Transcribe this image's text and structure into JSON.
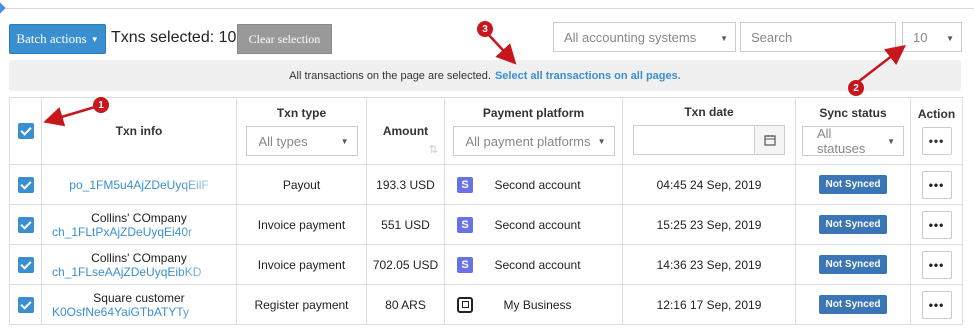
{
  "toolbar": {
    "batch_actions_label": "Batch actions",
    "txns_selected_label": "Txns selected:",
    "txns_selected_count": "10",
    "clear_selection_label": "Clear selection",
    "accounting_select_value": "All accounting systems",
    "search_placeholder": "Search",
    "per_page_value": "10"
  },
  "banner": {
    "text": "All transactions on the page are selected.",
    "link": "Select all transactions on all pages."
  },
  "table": {
    "headers": {
      "txn_info": "Txn info",
      "txn_type": "Txn type",
      "amount": "Amount",
      "payment_platform": "Payment platform",
      "txn_date": "Txn date",
      "sync_status": "Sync status",
      "action": "Action"
    },
    "filters": {
      "txn_type": "All types",
      "payment_platform": "All payment platforms",
      "sync_status": "All statuses"
    },
    "rows": [
      {
        "name": "",
        "id": "po_1FM5u4AjZDeUyqEilF",
        "type": "Payout",
        "amount": "193.3 USD",
        "platform": "Second account",
        "platform_icon": "stripe-icon",
        "date": "04:45 24 Sep, 2019",
        "status": "Not Synced",
        "action": "•••"
      },
      {
        "name": "Collins' COmpany",
        "id": "ch_1FLtPxAjZDeUyqEi40r",
        "type": "Invoice payment",
        "amount": "551 USD",
        "platform": "Second account",
        "platform_icon": "stripe-icon",
        "date": "15:25 23 Sep, 2019",
        "status": "Not Synced",
        "action": "•••"
      },
      {
        "name": "Collins' COmpany",
        "id": "ch_1FLseAAjZDeUyqEibKD",
        "type": "Invoice payment",
        "amount": "702.05 USD",
        "platform": "Second account",
        "platform_icon": "stripe-icon",
        "date": "14:36 23 Sep, 2019",
        "status": "Not Synced",
        "action": "•••"
      },
      {
        "name": "Square customer",
        "id": "K0OsfNe64YaiGTbATYTy",
        "type": "Register payment",
        "amount": "80 ARS",
        "platform": "My Business",
        "platform_icon": "square-icon",
        "date": "12:16 17 Sep, 2019",
        "status": "Not Synced",
        "action": "•••"
      }
    ]
  },
  "annotations": [
    "1",
    "2",
    "3"
  ],
  "colors": {
    "accent": "#3a8fd0",
    "badge": "#3a75b5",
    "annotation": "#c8161d",
    "stripe": "#6772e5"
  }
}
